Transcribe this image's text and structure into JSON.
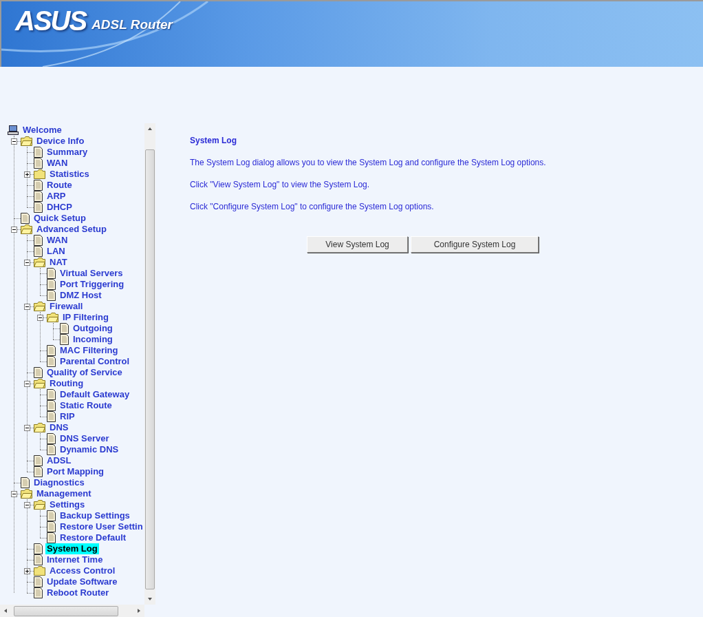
{
  "header": {
    "logo": "ASUS",
    "product": "ADSL Router"
  },
  "tree": {
    "label": "Welcome",
    "kind": "root",
    "selected": false,
    "children": [
      {
        "label": "Device Info",
        "kind": "folder",
        "expanded": true,
        "selected": false,
        "children": [
          {
            "label": "Summary",
            "kind": "page",
            "selected": false
          },
          {
            "label": "WAN",
            "kind": "page",
            "selected": false
          },
          {
            "label": "Statistics",
            "kind": "folder",
            "expanded": false,
            "selected": false
          },
          {
            "label": "Route",
            "kind": "page",
            "selected": false
          },
          {
            "label": "ARP",
            "kind": "page",
            "selected": false
          },
          {
            "label": "DHCP",
            "kind": "page",
            "selected": false
          }
        ]
      },
      {
        "label": "Quick Setup",
        "kind": "page",
        "selected": false
      },
      {
        "label": "Advanced Setup",
        "kind": "folder",
        "expanded": true,
        "selected": false,
        "children": [
          {
            "label": "WAN",
            "kind": "page",
            "selected": false
          },
          {
            "label": "LAN",
            "kind": "page",
            "selected": false
          },
          {
            "label": "NAT",
            "kind": "folder",
            "expanded": true,
            "selected": false,
            "children": [
              {
                "label": "Virtual Servers",
                "kind": "page",
                "selected": false
              },
              {
                "label": "Port Triggering",
                "kind": "page",
                "selected": false
              },
              {
                "label": "DMZ Host",
                "kind": "page",
                "selected": false
              }
            ]
          },
          {
            "label": "Firewall",
            "kind": "folder",
            "expanded": true,
            "selected": false,
            "children": [
              {
                "label": "IP Filtering",
                "kind": "folder",
                "expanded": true,
                "selected": false,
                "children": [
                  {
                    "label": "Outgoing",
                    "kind": "page",
                    "selected": false
                  },
                  {
                    "label": "Incoming",
                    "kind": "page",
                    "selected": false
                  }
                ]
              },
              {
                "label": "MAC Filtering",
                "kind": "page",
                "selected": false
              },
              {
                "label": "Parental Control",
                "kind": "page",
                "selected": false
              }
            ]
          },
          {
            "label": "Quality of Service",
            "kind": "page",
            "selected": false
          },
          {
            "label": "Routing",
            "kind": "folder",
            "expanded": true,
            "selected": false,
            "children": [
              {
                "label": "Default Gateway",
                "kind": "page",
                "selected": false
              },
              {
                "label": "Static Route",
                "kind": "page",
                "selected": false
              },
              {
                "label": "RIP",
                "kind": "page",
                "selected": false
              }
            ]
          },
          {
            "label": "DNS",
            "kind": "folder",
            "expanded": true,
            "selected": false,
            "children": [
              {
                "label": "DNS Server",
                "kind": "page",
                "selected": false
              },
              {
                "label": "Dynamic DNS",
                "kind": "page",
                "selected": false
              }
            ]
          },
          {
            "label": "ADSL",
            "kind": "page",
            "selected": false
          },
          {
            "label": "Port Mapping",
            "kind": "page",
            "selected": false
          }
        ]
      },
      {
        "label": "Diagnostics",
        "kind": "page",
        "selected": false
      },
      {
        "label": "Management",
        "kind": "folder",
        "expanded": true,
        "selected": false,
        "children": [
          {
            "label": "Settings",
            "kind": "folder",
            "expanded": true,
            "selected": false,
            "children": [
              {
                "label": "Backup Settings",
                "kind": "page",
                "selected": false
              },
              {
                "label": "Restore User Settin",
                "kind": "page",
                "selected": false
              },
              {
                "label": "Restore Default",
                "kind": "page",
                "selected": false
              }
            ]
          },
          {
            "label": "System Log",
            "kind": "page",
            "selected": true
          },
          {
            "label": "Internet Time",
            "kind": "page",
            "selected": false
          },
          {
            "label": "Access Control",
            "kind": "folder",
            "expanded": false,
            "selected": false
          },
          {
            "label": "Update Software",
            "kind": "page",
            "selected": false
          },
          {
            "label": "Reboot Router",
            "kind": "page",
            "selected": false
          }
        ]
      }
    ]
  },
  "content": {
    "title": "System Log",
    "paragraphs": [
      "The System Log dialog allows you to view the System Log and configure the System Log options.",
      "Click \"View System Log\" to view the System Log.",
      "Click \"Configure System Log\" to configure the System Log options."
    ],
    "buttons": [
      "View System Log",
      "Configure System Log"
    ]
  }
}
